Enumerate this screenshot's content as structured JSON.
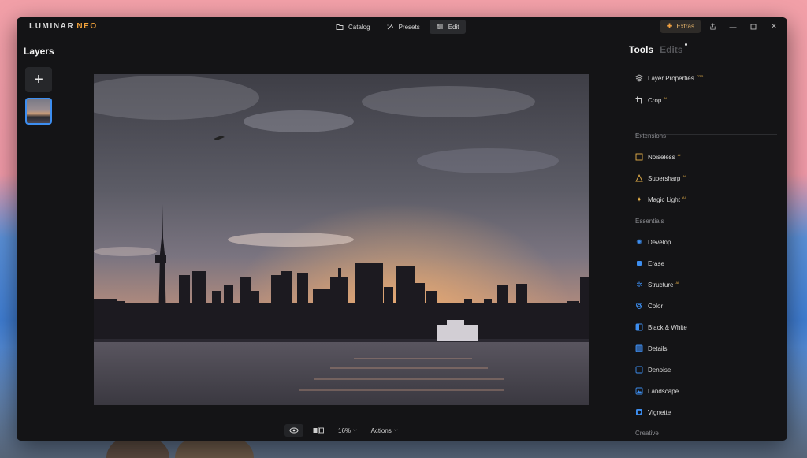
{
  "app": {
    "logo_main": "LUMINAR",
    "logo_accent": "NEO"
  },
  "nav": {
    "catalog": "Catalog",
    "presets": "Presets",
    "edit": "Edit"
  },
  "extras_label": "Extras",
  "layers": {
    "title": "Layers",
    "add_symbol": "+"
  },
  "bottom": {
    "zoom": "16%",
    "actions": "Actions"
  },
  "panel": {
    "tab_tools": "Tools",
    "tab_edits": "Edits",
    "top_tools": [
      {
        "label": "Layer Properties",
        "badge": "PRO"
      },
      {
        "label": "Crop",
        "badge": "AI"
      }
    ],
    "extensions_title": "Extensions",
    "extensions": [
      {
        "label": "Noiseless",
        "badge": "AI"
      },
      {
        "label": "Supersharp",
        "badge": "AI"
      },
      {
        "label": "Magic Light",
        "badge": "AI"
      }
    ],
    "essentials_title": "Essentials",
    "essentials": [
      {
        "label": "Develop",
        "badge": ""
      },
      {
        "label": "Erase",
        "badge": ""
      },
      {
        "label": "Structure",
        "badge": "AI"
      },
      {
        "label": "Color",
        "badge": ""
      },
      {
        "label": "Black & White",
        "badge": ""
      },
      {
        "label": "Details",
        "badge": ""
      },
      {
        "label": "Denoise",
        "badge": ""
      },
      {
        "label": "Landscape",
        "badge": ""
      },
      {
        "label": "Vignette",
        "badge": ""
      }
    ],
    "creative_title": "Creative"
  },
  "colors": {
    "accent": "#3d8ef0",
    "extras": "#f0a040",
    "panel_bg": "#141416"
  }
}
